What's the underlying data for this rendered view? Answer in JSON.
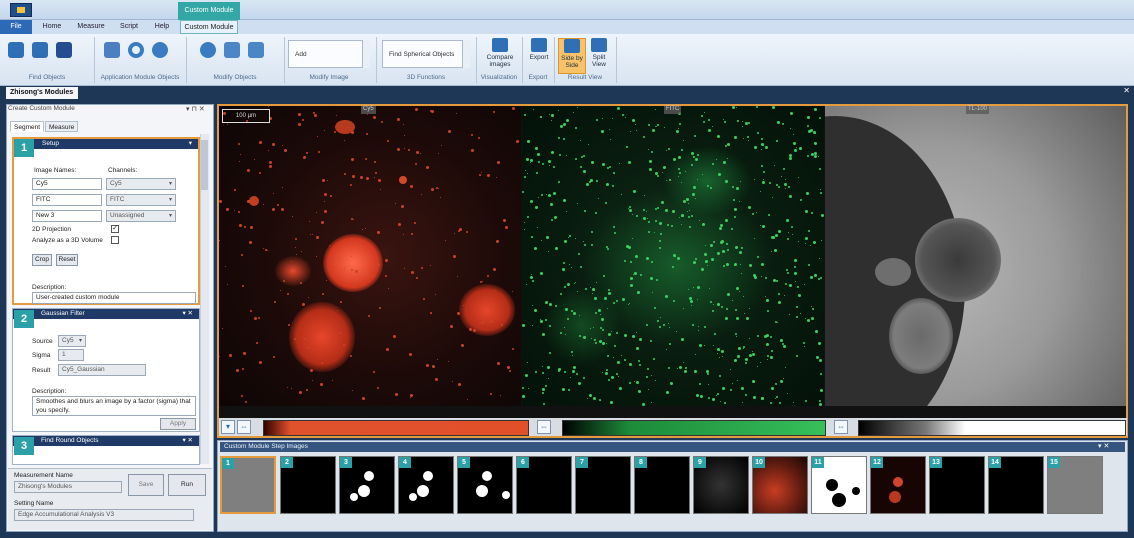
{
  "titlebar": {
    "context_header": "Custom Module"
  },
  "menu": {
    "file": "File",
    "home": "Home",
    "measure": "Measure",
    "script": "Script",
    "help": "Help",
    "custom_module": "Custom Module"
  },
  "ribbon": {
    "groups": {
      "find_objects": "Find Objects",
      "application_module_objects": "Application Module Objects",
      "modify_objects": "Modify Objects",
      "modify_image": "Modify Image",
      "three_d_functions": "3D Functions",
      "visualization": "Visualization",
      "export": "Export",
      "result_view": "Result View"
    },
    "modify_image_dropdown": "Add",
    "three_d_dropdown": "Find Spherical Objects",
    "compare_images": "Compare images",
    "export_button": "Export",
    "side_by_side": "Side by Side",
    "split_view": "Split View"
  },
  "module_tab": "Zhisong's Modules",
  "left_panel": {
    "title": "Create Custom Module",
    "tabs": [
      "Segment",
      "Measure"
    ],
    "step1": {
      "number": "1",
      "title": "Setup",
      "image_names_label": "Image Names:",
      "channels_label": "Channels:",
      "rows": [
        {
          "name": "Cy5",
          "channel": "Cy5"
        },
        {
          "name": "FITC",
          "channel": "FITC"
        },
        {
          "name": "New 3",
          "channel": "Unassigned"
        }
      ],
      "projection_label": "2D Projection",
      "projection_check": "✓",
      "volume_label": "Analyze as a 3D Volume",
      "crop_button": "Crop",
      "reset_button": "Reset",
      "description_label": "Description:",
      "description": "User-created custom module"
    },
    "step2": {
      "number": "2",
      "title": "Gaussian Filter",
      "source_label": "Source",
      "source_value": "Cy5",
      "sigma_label": "Sigma",
      "sigma_value": "1",
      "result_label": "Result",
      "result_value": "Cy5_Gaussian",
      "description_label": "Description:",
      "description": "Smoothes and blurs an image by a factor (sigma) that you specify.",
      "apply_button": "Apply"
    },
    "step3": {
      "number": "3",
      "title": "Find Round Objects"
    },
    "measurement_name_label": "Measurement Name",
    "measurement_name": "Zhisong's Modules",
    "save_button": "Save",
    "run_button": "Run",
    "setting_name_label": "Setting Name",
    "setting_name": "Edge Accumulational Analysis V3"
  },
  "viewer": {
    "scale_label": "100 µm",
    "panels": [
      "Cy5",
      "FITC",
      "TL-100"
    ]
  },
  "strip": {
    "title": "Custom Module Step Images",
    "numbers": [
      "1",
      "2",
      "3",
      "4",
      "5",
      "6",
      "7",
      "8",
      "9",
      "10",
      "11",
      "12",
      "13",
      "14",
      "15"
    ]
  },
  "colors": {
    "accent": "#e59a3d",
    "teal": "#2ba1a7",
    "navy": "#1f3a66",
    "red_channel": "#e2502a",
    "green_channel": "#36c05a"
  },
  "icons": [
    "app-icon",
    "swap-icon",
    "close-icon",
    "pin-icon",
    "chevron-down-icon"
  ]
}
